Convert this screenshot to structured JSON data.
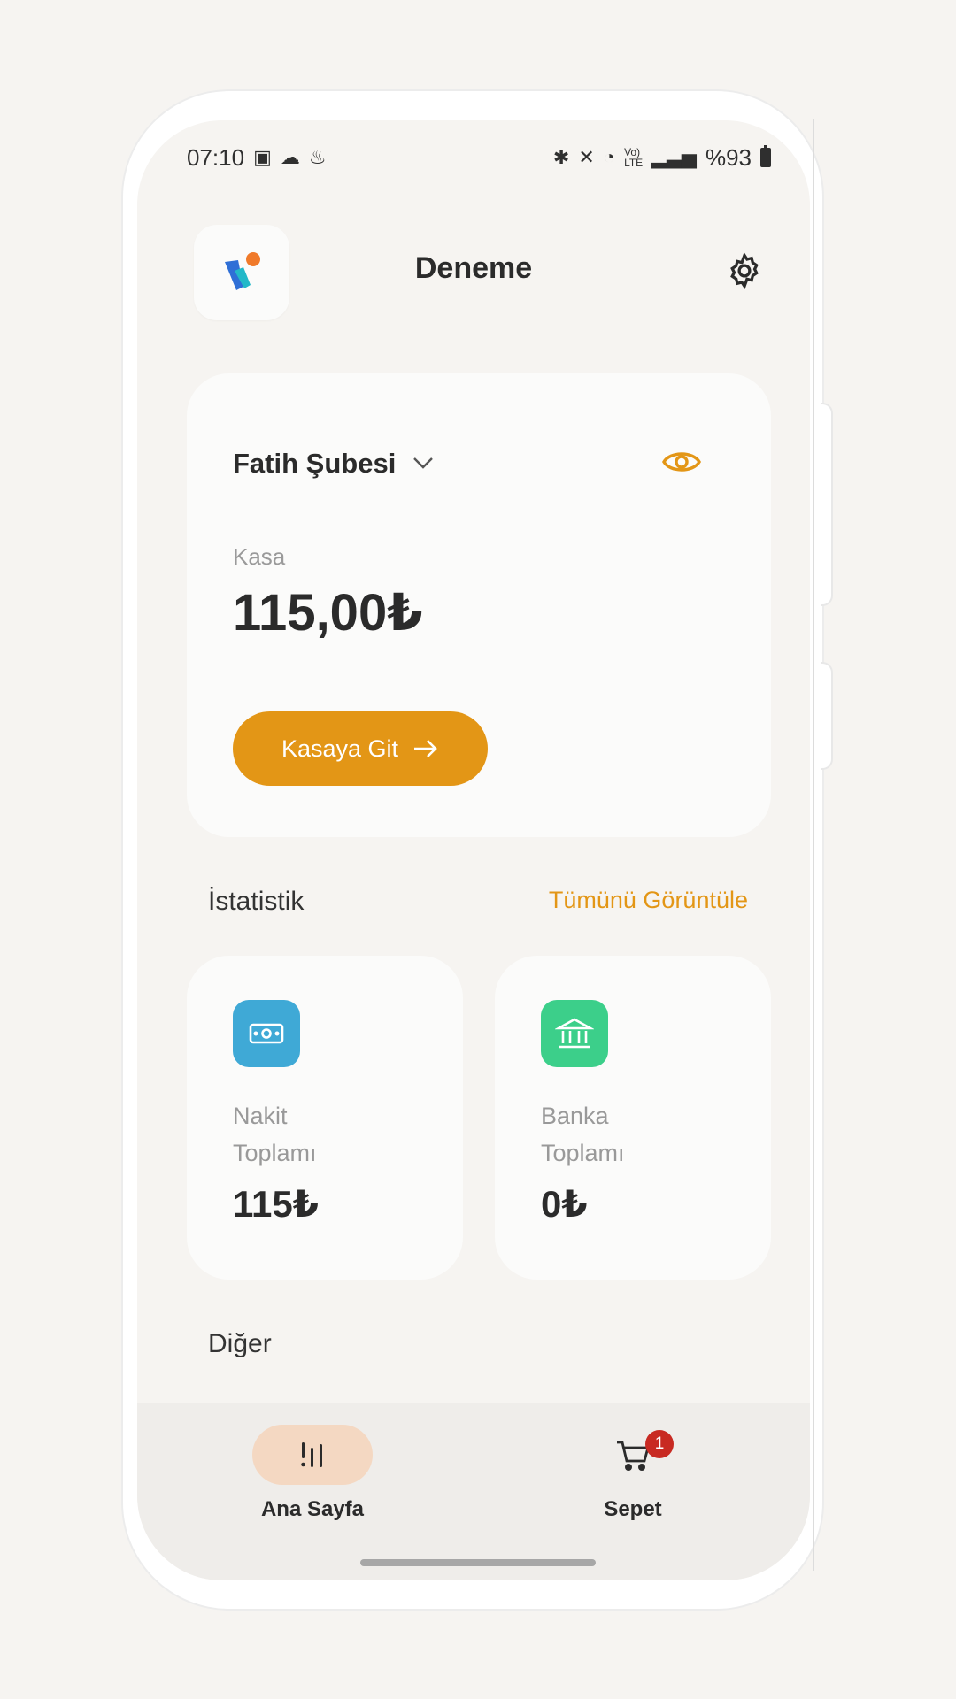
{
  "status_bar": {
    "time": "07:10",
    "left_icons": [
      "gallery-icon",
      "weather-icon",
      "notification-icon"
    ],
    "right_icons": [
      "bluetooth-icon",
      "mute-icon",
      "wifi-icon",
      "volte-icon",
      "signal-icon"
    ],
    "battery": "%93"
  },
  "header": {
    "title": "Deneme",
    "logo_icon": "app-logo-icon",
    "settings_icon": "gear-icon"
  },
  "main_card": {
    "branch": "Fatih Şubesi",
    "label": "Kasa",
    "amount": "115,00₺",
    "button_label": "Kasaya Git"
  },
  "statistics": {
    "title": "İstatistik",
    "link": "Tümünü Görüntüle",
    "cards": [
      {
        "label_line1": "Nakit",
        "label_line2": "Toplamı",
        "value": "115₺",
        "icon": "cash-icon",
        "color": "#3fa9d6"
      },
      {
        "label_line1": "Banka",
        "label_line2": "Toplamı",
        "value": "0₺",
        "icon": "bank-icon",
        "color": "#3ccf8a"
      }
    ]
  },
  "other": {
    "title": "Diğer"
  },
  "bottom_nav": {
    "items": [
      {
        "label": "Ana Sayfa",
        "icon": "home-stats-icon",
        "active": true
      },
      {
        "label": "Sepet",
        "icon": "cart-icon",
        "badge": "1"
      }
    ]
  },
  "colors": {
    "accent": "#e39616",
    "badge": "#c82a22",
    "background": "#f6f4f1"
  }
}
